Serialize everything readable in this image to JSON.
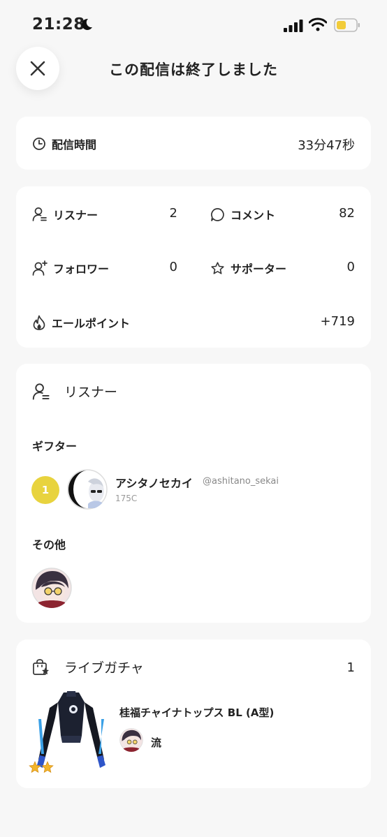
{
  "status_bar": {
    "time": "21:28"
  },
  "header": {
    "title": "この配信は終了しました"
  },
  "duration": {
    "label": "配信時間",
    "value": "33分47秒"
  },
  "stats": {
    "listeners": {
      "label": "リスナー",
      "value": "2"
    },
    "comments": {
      "label": "コメント",
      "value": "82"
    },
    "followers": {
      "label": "フォロワー",
      "value": "0"
    },
    "supporters": {
      "label": "サポーター",
      "value": "0"
    },
    "yell_points": {
      "label": "エールポイント",
      "value": "+719"
    }
  },
  "listener_section": {
    "title": "リスナー",
    "gifters_label": "ギフター",
    "gifter": {
      "rank": "1",
      "name": "アシタノセカイ",
      "handle": "@ashitano_sekai",
      "sub": "175C"
    },
    "others_label": "その他"
  },
  "gacha_section": {
    "title": "ライブガチャ",
    "count": "1",
    "item": {
      "name": "桂福チャイナトップス BL (A型)",
      "owner": "流",
      "stars": 2
    }
  },
  "colors": {
    "accent_yellow": "#e8d33e",
    "card_bg": "#ffffff",
    "page_bg": "#f7f7f7"
  }
}
